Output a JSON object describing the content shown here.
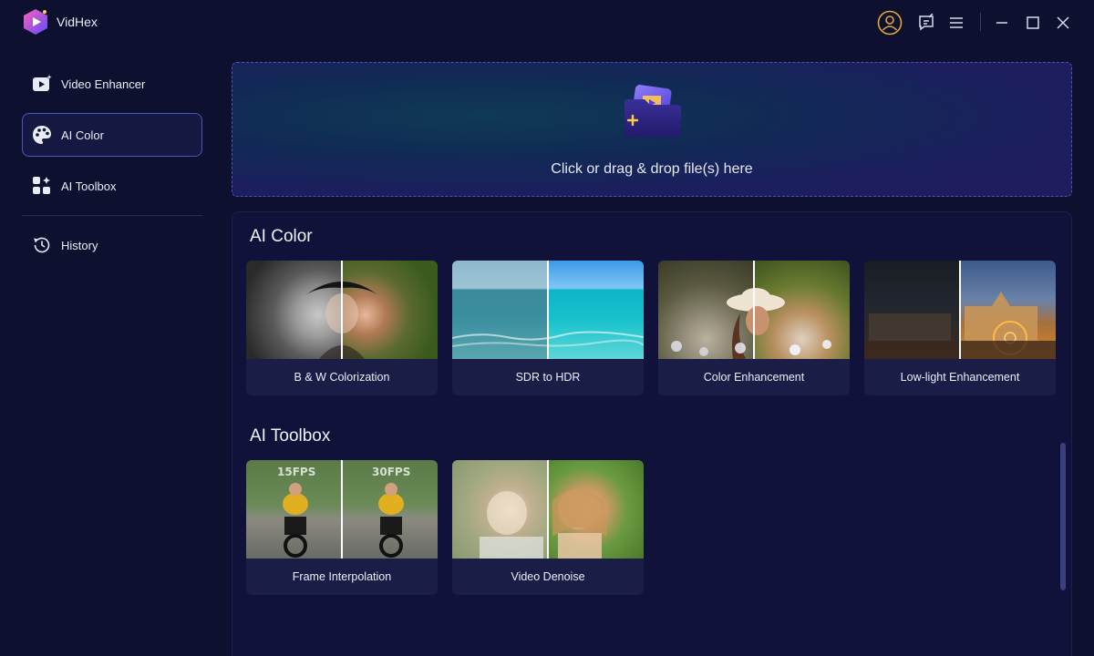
{
  "app": {
    "title": "VidHex"
  },
  "sidebar": {
    "items": [
      {
        "label": "Video Enhancer",
        "icon": "video-enhancer-icon"
      },
      {
        "label": "AI Color",
        "icon": "palette-icon",
        "active": true
      },
      {
        "label": "AI Toolbox",
        "icon": "toolbox-icon"
      },
      {
        "label": "History",
        "icon": "history-icon"
      }
    ]
  },
  "dropzone": {
    "text": "Click or drag & drop file(s) here"
  },
  "sections": {
    "ai_color": {
      "title": "AI Color",
      "cards": [
        {
          "label": "B & W Colorization"
        },
        {
          "label": "SDR to HDR"
        },
        {
          "label": "Color Enhancement"
        },
        {
          "label": "Low-light Enhancement"
        }
      ]
    },
    "ai_toolbox": {
      "title": "AI Toolbox",
      "cards": [
        {
          "label": "Frame Interpolation",
          "left_badge": "15FPS",
          "right_badge": "30FPS"
        },
        {
          "label": "Video Denoise"
        }
      ]
    }
  },
  "colors": {
    "accent": "#4a57b8",
    "background": "#0e1030",
    "profile": "#e0a73a"
  }
}
